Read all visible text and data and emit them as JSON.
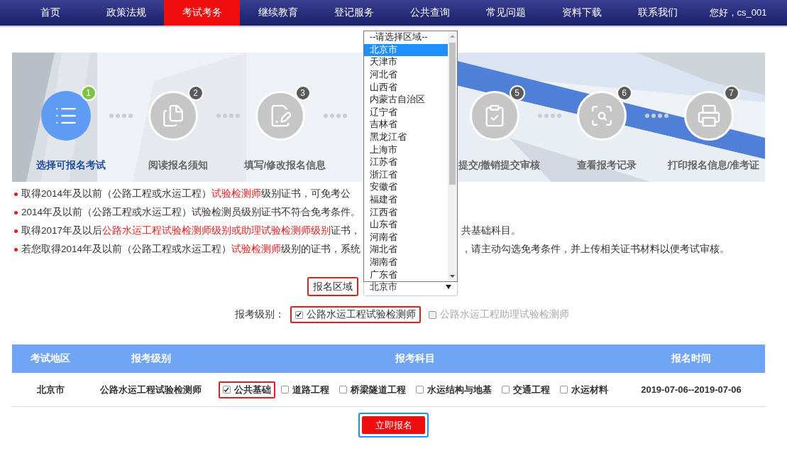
{
  "nav": {
    "items": [
      {
        "label": "首页",
        "selected": false
      },
      {
        "label": "政策法规",
        "selected": false
      },
      {
        "label": "考试考务",
        "selected": true
      },
      {
        "label": "继续教育",
        "selected": false
      },
      {
        "label": "登记服务",
        "selected": false
      },
      {
        "label": "公共查询",
        "selected": false
      },
      {
        "label": "常见问题",
        "selected": false
      },
      {
        "label": "资料下载",
        "selected": false
      },
      {
        "label": "联系我们",
        "selected": false
      }
    ],
    "greeting": "您好，cs_001"
  },
  "steps": [
    {
      "number": "1",
      "label": "选择可报名考试",
      "kind": "list",
      "selected": true
    },
    {
      "number": "2",
      "label": "阅读报名须知",
      "kind": "documents",
      "selected": false
    },
    {
      "number": "3",
      "label": "填写/修改报名信息",
      "kind": "edit",
      "selected": false
    },
    {
      "number": "5",
      "label": "提交/撤销提交审核",
      "kind": "clipboard",
      "selected": false
    },
    {
      "number": "6",
      "label": "查看报考记录",
      "kind": "search",
      "selected": false
    },
    {
      "number": "7",
      "label": "打印报名信息/准考证",
      "kind": "printer",
      "selected": false
    }
  ],
  "notes": [
    {
      "left": [
        {
          "text": "取得2014年及以前（公路工程或水运工程）",
          "red": false
        },
        {
          "text": "试验检测师",
          "red": true
        },
        {
          "text": "级别证书，可免考公",
          "red": false
        }
      ]
    },
    {
      "left": [
        {
          "text": "2014年及以前（公路工程或水运工程）试验检测员级别证书不符合免考条件。",
          "red": false
        }
      ]
    },
    {
      "left": [
        {
          "text": "取得2017年及以后",
          "red": false
        },
        {
          "text": "公路水运工程试验检测师级别或助理试验检测师级别",
          "red": true
        },
        {
          "text": "证书，",
          "red": false
        }
      ],
      "right": [
        {
          "text": "共基础科目。",
          "red": false
        }
      ]
    },
    {
      "left": [
        {
          "text": "若您取得2014年及以前（公路工程或水运工程）",
          "red": false
        },
        {
          "text": "试验检测师",
          "red": true
        },
        {
          "text": "级别的证书，系统",
          "red": false
        }
      ],
      "right": [
        {
          "text": "，请主动勾选免考条件，并上传相关证书材料以便考试审核。",
          "red": false
        }
      ]
    }
  ],
  "region": {
    "label": "报名区域",
    "highlighted": true,
    "value": "北京市",
    "options": [
      {
        "label": "--请选择区域--",
        "selected": false
      },
      {
        "label": "北京市",
        "selected": true
      },
      {
        "label": "天津市",
        "selected": false
      },
      {
        "label": "河北省",
        "selected": false
      },
      {
        "label": "山西省",
        "selected": false
      },
      {
        "label": "内蒙古自治区",
        "selected": false
      },
      {
        "label": "辽宁省",
        "selected": false
      },
      {
        "label": "吉林省",
        "selected": false
      },
      {
        "label": "黑龙江省",
        "selected": false
      },
      {
        "label": "上海市",
        "selected": false
      },
      {
        "label": "江苏省",
        "selected": false
      },
      {
        "label": "浙江省",
        "selected": false
      },
      {
        "label": "安徽省",
        "selected": false
      },
      {
        "label": "福建省",
        "selected": false
      },
      {
        "label": "江西省",
        "selected": false
      },
      {
        "label": "山东省",
        "selected": false
      },
      {
        "label": "河南省",
        "selected": false
      },
      {
        "label": "湖北省",
        "selected": false
      },
      {
        "label": "湖南省",
        "selected": false
      },
      {
        "label": "广东省",
        "selected": false
      }
    ]
  },
  "level": {
    "label": "报考级别：",
    "options": [
      {
        "label": "公路水运工程试验检测师",
        "checked": true,
        "disabled": false,
        "highlighted": true
      },
      {
        "label": "公路水运工程助理试验检测师",
        "checked": false,
        "disabled": true,
        "highlighted": false
      }
    ]
  },
  "table": {
    "columns": [
      "考试地区",
      "报考级别",
      "报考科目",
      "报名时间"
    ],
    "rows": [
      {
        "area": "北京市",
        "level": "公路水运工程试验检测师",
        "period": "2019-07-06--2019-07-06",
        "subjects": [
          {
            "label": "公共基础",
            "checked": true,
            "highlighted": true
          },
          {
            "label": "道路工程",
            "checked": false,
            "highlighted": false
          },
          {
            "label": "桥梁隧道工程",
            "checked": false,
            "highlighted": false
          },
          {
            "label": "水运结构与地基",
            "checked": false,
            "highlighted": false
          },
          {
            "label": "交通工程",
            "checked": false,
            "highlighted": false
          },
          {
            "label": "水运材料",
            "checked": false,
            "highlighted": false
          }
        ]
      }
    ]
  },
  "submit": {
    "label": "立即报名",
    "highlighted": true
  }
}
